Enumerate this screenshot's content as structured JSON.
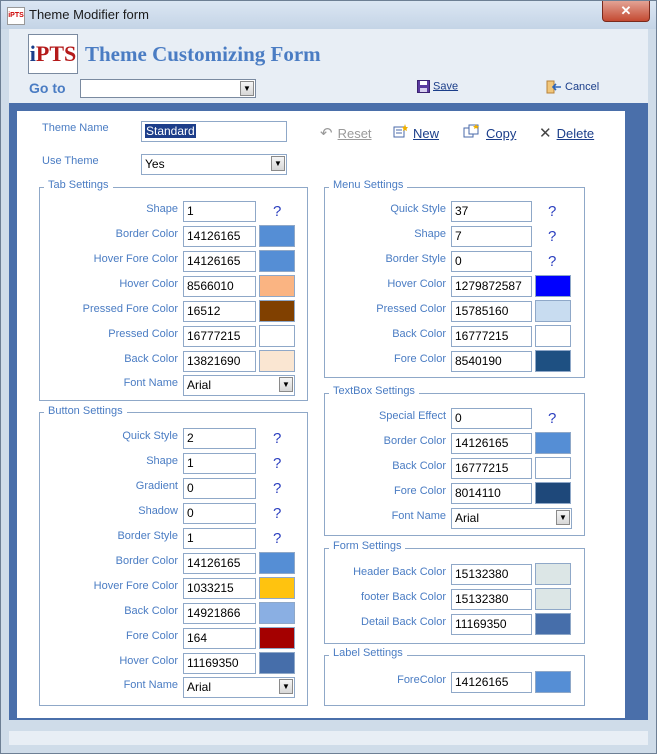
{
  "window": {
    "title": "Theme Modifier form",
    "app_icon_text": "iPTS",
    "close_glyph": "✕"
  },
  "header": {
    "logo": {
      "i": "i",
      "rest": "PTS"
    },
    "title": "Theme Customizing Form",
    "goto_label": "Go to",
    "goto_value": "",
    "save_label": "Save",
    "cancel_label": "Cancel"
  },
  "top": {
    "theme_name_label": "Theme Name",
    "theme_name_value": "Standard",
    "use_theme_label": "Use Theme",
    "use_theme_value": "Yes",
    "reset_label": "Reset",
    "new_label": "New",
    "copy_label": "Copy",
    "delete_label": "Delete"
  },
  "help_glyph": "?",
  "dropdown_glyph": "▼",
  "tab_settings": {
    "title": "Tab Settings",
    "fields": [
      {
        "label": "Shape",
        "value": "1",
        "help": true
      },
      {
        "label": "Border Color",
        "value": "14126165",
        "color": "#558ED5"
      },
      {
        "label": "Hover Fore Color",
        "value": "14126165",
        "color": "#558ED5"
      },
      {
        "label": "Hover Color",
        "value": "8566010",
        "color": "#FAB482"
      },
      {
        "label": "Pressed Fore Color",
        "value": "16512",
        "color": "#804000"
      },
      {
        "label": "Pressed Color",
        "value": "16777215",
        "color": "#FFFFFF"
      },
      {
        "label": "Back Color",
        "value": "13821690",
        "color": "#FAE6D2"
      }
    ],
    "font_label": "Font Name",
    "font_value": "Arial"
  },
  "button_settings": {
    "title": "Button Settings",
    "fields": [
      {
        "label": "Quick Style",
        "value": "2",
        "help": true
      },
      {
        "label": "Shape",
        "value": "1",
        "help": true
      },
      {
        "label": "Gradient",
        "value": "0",
        "help": true
      },
      {
        "label": "Shadow",
        "value": "0",
        "help": true
      },
      {
        "label": "Border Style",
        "value": "1",
        "help": true
      },
      {
        "label": "Border Color",
        "value": "14126165",
        "color": "#558ED5"
      },
      {
        "label": "Hover Fore Color",
        "value": "1033215",
        "color": "#FFC30F"
      },
      {
        "label": "Back Color",
        "value": "14921866",
        "color": "#8AAFE3"
      },
      {
        "label": "Fore Color",
        "value": "164",
        "color": "#A40000"
      },
      {
        "label": "Hover Color",
        "value": "11169350",
        "color": "#466EAA"
      }
    ],
    "font_label": "Font Name",
    "font_value": "Arial"
  },
  "menu_settings": {
    "title": "Menu Settings",
    "fields": [
      {
        "label": "Quick Style",
        "value": "37",
        "help": true
      },
      {
        "label": "Shape",
        "value": "7",
        "help": true
      },
      {
        "label": "Border Style",
        "value": "0",
        "help": true
      },
      {
        "label": "Hover Color",
        "value": "1279872587",
        "color": "#0000FF"
      },
      {
        "label": "Pressed Color",
        "value": "15785160",
        "color": "#C8DCF0"
      },
      {
        "label": "Back Color",
        "value": "16777215",
        "color": "#FFFFFF"
      },
      {
        "label": "Fore Color",
        "value": "8540190",
        "color": "#1E5082"
      }
    ]
  },
  "textbox_settings": {
    "title": "TextBox Settings",
    "fields": [
      {
        "label": "Special Effect",
        "value": "0",
        "help": true
      },
      {
        "label": "Border Color",
        "value": "14126165",
        "color": "#558ED5"
      },
      {
        "label": "Back Color",
        "value": "16777215",
        "color": "#FFFFFF"
      },
      {
        "label": "Fore Color",
        "value": "8014110",
        "color": "#1E487A"
      }
    ],
    "font_label": "Font Name",
    "font_value": "Arial"
  },
  "form_settings": {
    "title": "Form Settings",
    "fields": [
      {
        "label": "Header Back Color",
        "value": "15132380",
        "color": "#DCE6E6"
      },
      {
        "label": "footer Back Color",
        "value": "15132380",
        "color": "#DCE6E6"
      },
      {
        "label": "Detail Back Color",
        "value": "11169350",
        "color": "#466EAA"
      }
    ]
  },
  "label_settings": {
    "title": "Label Settings",
    "fields": [
      {
        "label": "ForeColor",
        "value": "14126165",
        "color": "#558ED5"
      }
    ]
  }
}
